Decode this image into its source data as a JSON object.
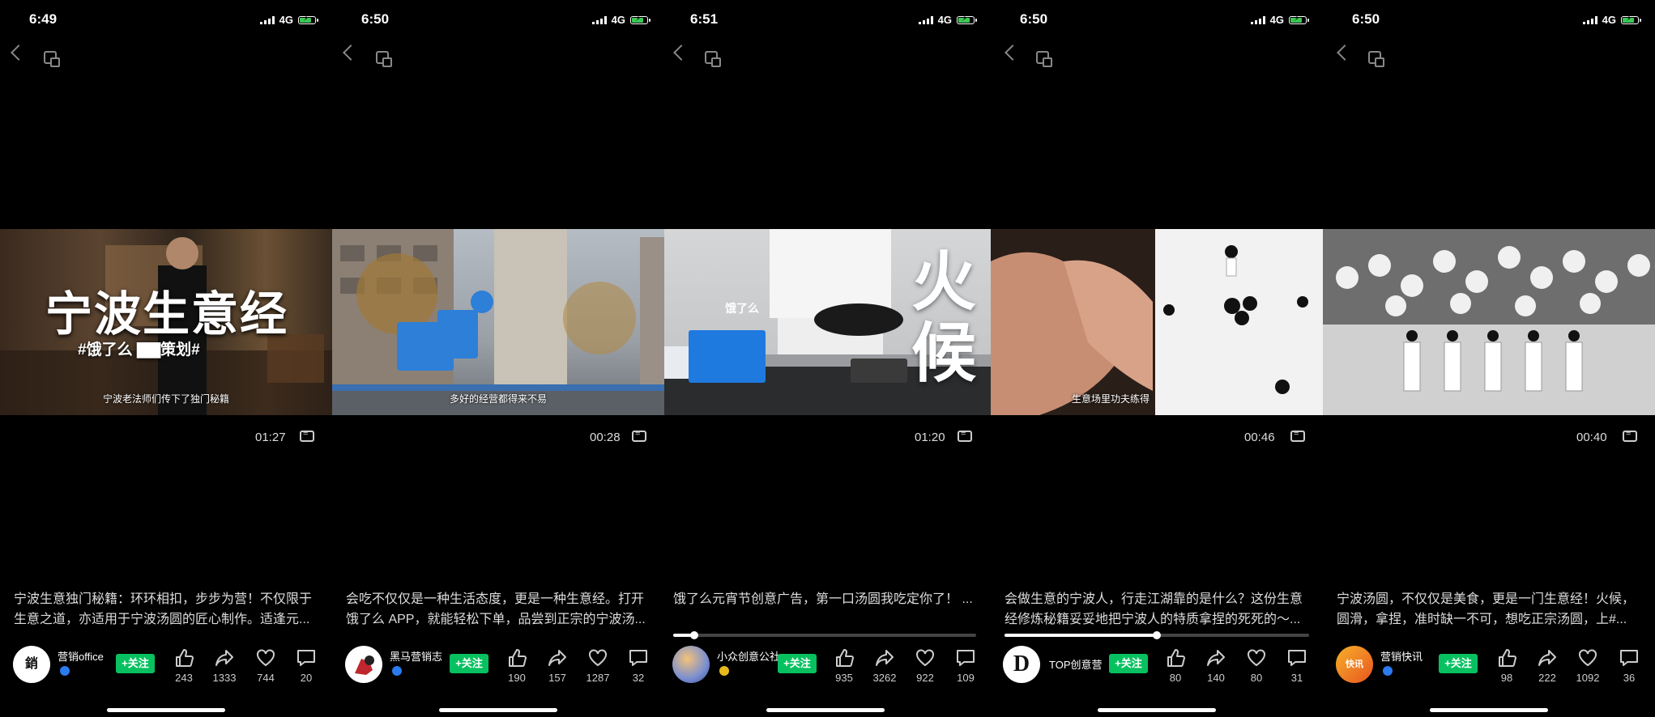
{
  "phones": [
    {
      "time": "6:49",
      "network": "4G",
      "duration": "01:27",
      "video_title": "宁波生意经",
      "video_tag": "#饿了么 ▇▇策划#",
      "video_subtitle": "宁波老法师们传下了独门秘籍",
      "caption": "宁波生意独门秘籍：环环相扣，步步为营！不仅限于生意之道，亦适用于宁波汤圆的匠心制作。适逢元...",
      "author": "营销office",
      "follow_label": "+关注",
      "likes": "243",
      "shares": "1333",
      "favorites": "744",
      "comments": "20"
    },
    {
      "time": "6:50",
      "network": "4G",
      "duration": "00:28",
      "video_subtitle": "多好的经营都得来不易",
      "caption": "会吃不仅仅是一种生活态度，更是一种生意经。打开饿了么 APP，就能轻松下单，品尝到正宗的宁波汤...",
      "author": "黑马营销志",
      "follow_label": "+关注",
      "likes": "190",
      "shares": "157",
      "favorites": "1287",
      "comments": "32"
    },
    {
      "time": "6:51",
      "network": "4G",
      "duration": "01:20",
      "video_title": "火候",
      "box_label": "饿了么",
      "caption": "饿了么元宵节创意广告，第一口汤圆我吃定你了！ ...",
      "author": "小众创意公社",
      "follow_label": "+关注",
      "likes": "935",
      "shares": "3262",
      "favorites": "922",
      "comments": "109",
      "progress": 0.07
    },
    {
      "time": "6:50",
      "network": "4G",
      "duration": "00:46",
      "video_subtitle": "生意场里功夫练得",
      "caption": "会做生意的宁波人，行走江湖靠的是什么？这份生意经修炼秘籍妥妥地把宁波人的特质拿捏的死死的～...",
      "author": "TOP创意营",
      "follow_label": "+关注",
      "likes": "80",
      "shares": "140",
      "favorites": "80",
      "comments": "31",
      "progress": 0.5
    },
    {
      "time": "6:50",
      "network": "4G",
      "duration": "00:40",
      "caption": "宁波汤圆，不仅仅是美食，更是一门生意经！火候，圆滑，拿捏，准时缺一不可，想吃正宗汤圆，上#...",
      "author": "营销快讯",
      "follow_label": "+关注",
      "likes": "98",
      "shares": "222",
      "favorites": "1092",
      "comments": "36"
    }
  ],
  "colors": {
    "follow_green": "#07c160",
    "verified_blue": "#2a7bef",
    "battery_green": "#3cc854"
  }
}
